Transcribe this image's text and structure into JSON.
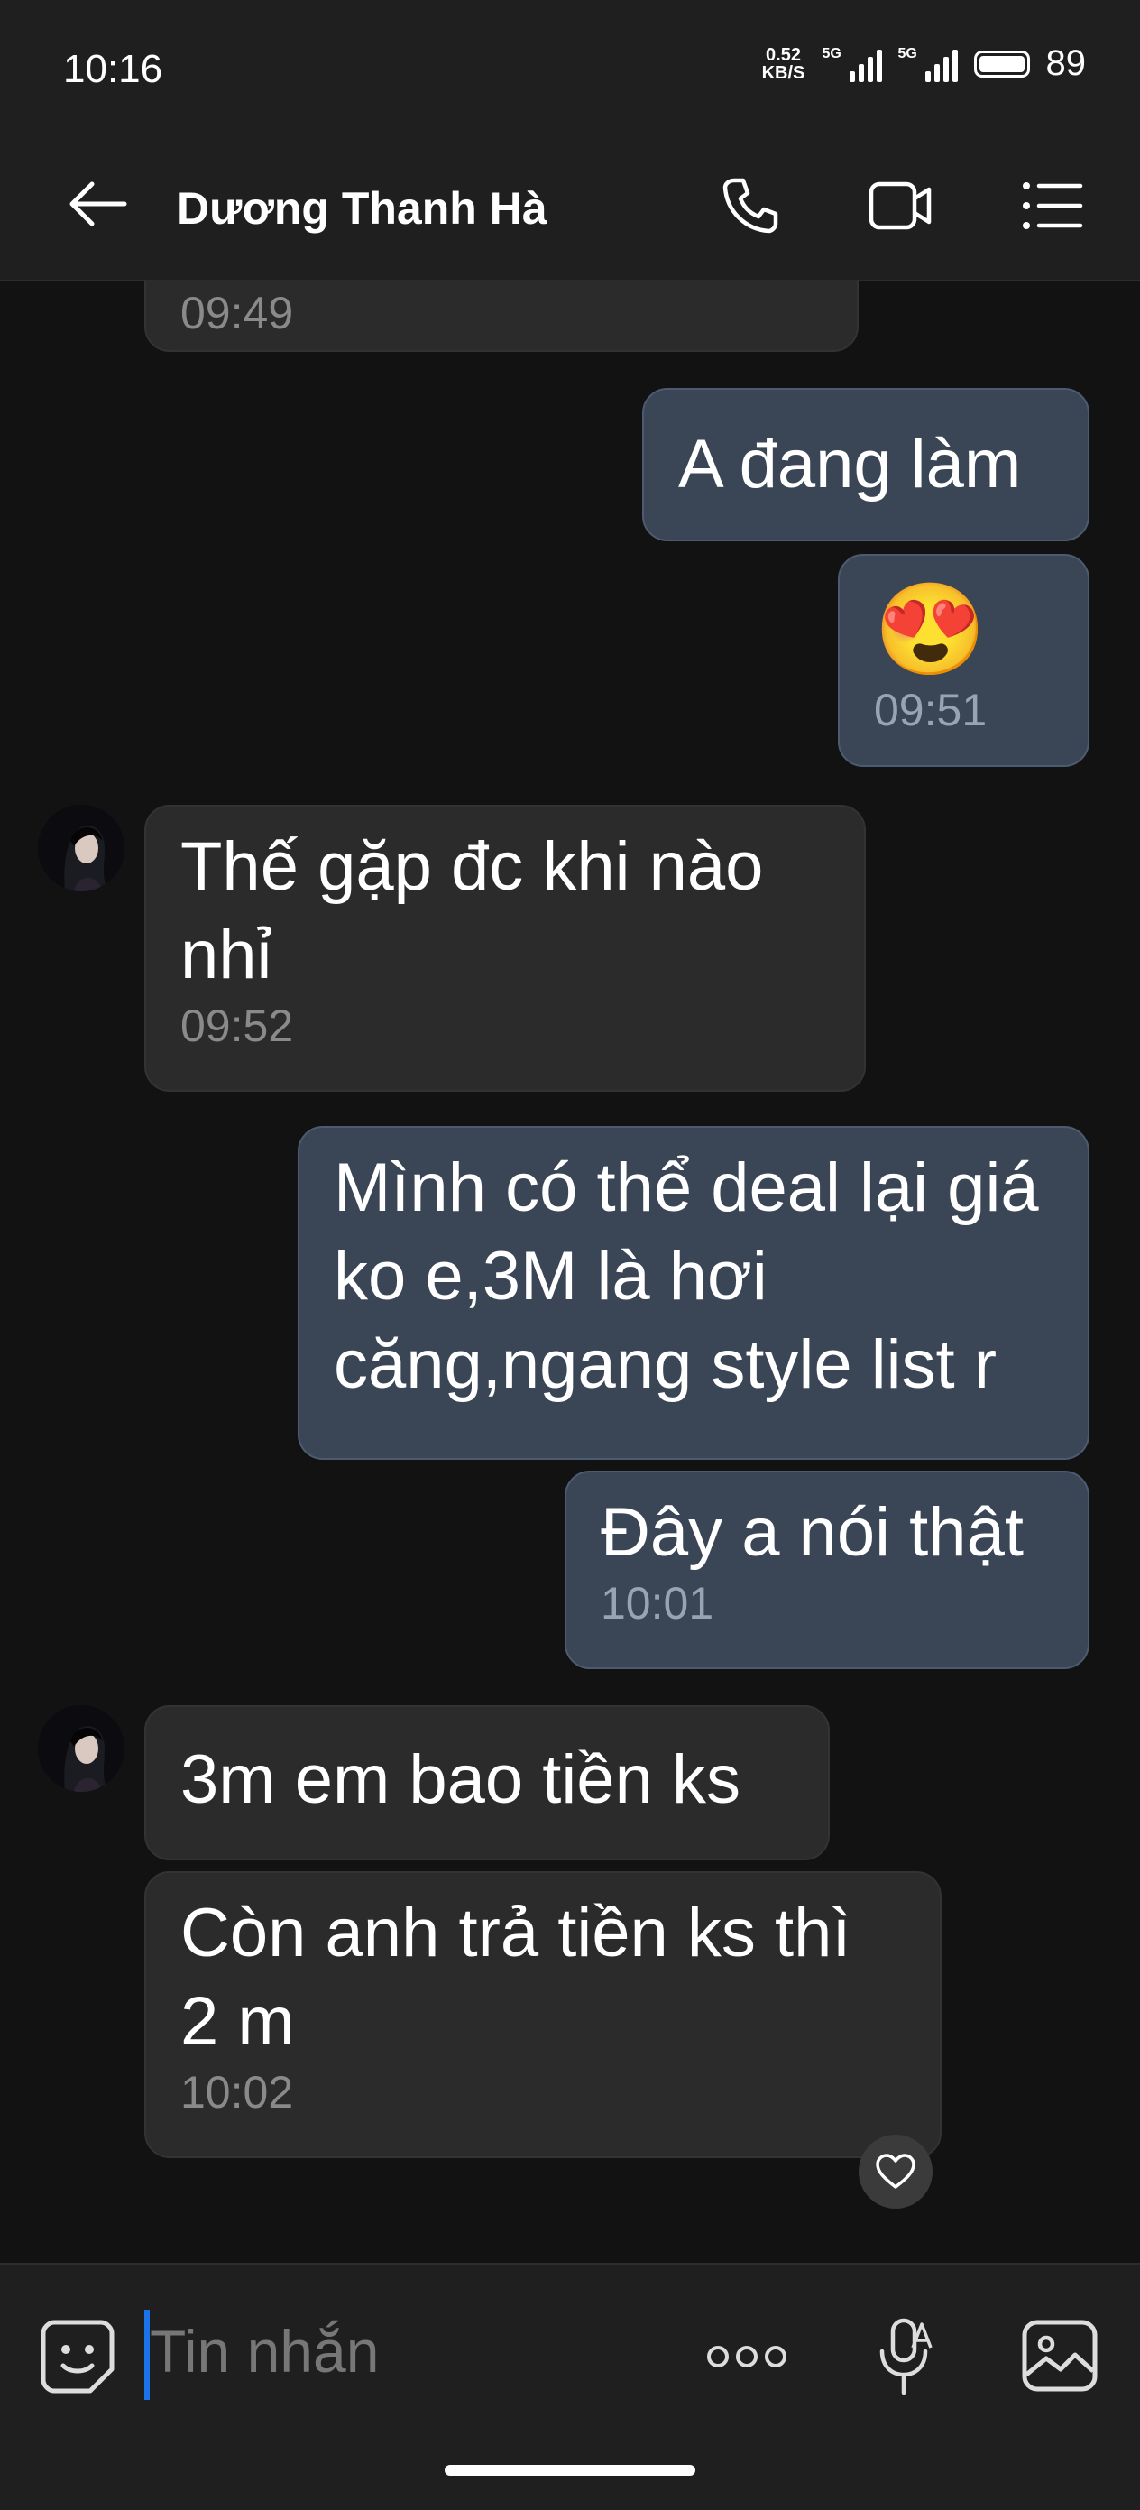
{
  "status": {
    "time": "10:16",
    "net_speed_value": "0.52",
    "net_speed_unit": "KB/S",
    "sim1": "5G",
    "sim2": "5G",
    "battery": "89"
  },
  "header": {
    "title": "Dương Thanh Hà"
  },
  "messages": [
    {
      "dir": "in",
      "text": "",
      "time": "09:49"
    },
    {
      "dir": "out",
      "text": "A đang làm",
      "time": ""
    },
    {
      "dir": "out",
      "text": "😍",
      "time": "09:51"
    },
    {
      "dir": "in",
      "text": "Thế gặp đc khi nào nhỉ",
      "time": "09:52"
    },
    {
      "dir": "out",
      "text": "Mình có thể deal lại giá ko e,3M là hơi căng,ngang style list r",
      "time": ""
    },
    {
      "dir": "out",
      "text": "Đây a nói thật",
      "time": "10:01"
    },
    {
      "dir": "in",
      "text": "3m em bao tiền ks",
      "time": ""
    },
    {
      "dir": "in",
      "text": "Còn anh trả tiền ks thì 2 m",
      "time": "10:02"
    }
  ],
  "input": {
    "placeholder": "Tin nhắn"
  },
  "colors": {
    "incoming_bubble": "#2b2b2b",
    "outgoing_bubble": "#3a4556",
    "caret": "#1a73e8"
  },
  "icons": [
    "back-arrow-icon",
    "phone-icon",
    "video-call-icon",
    "menu-list-icon",
    "sticker-icon",
    "more-icon",
    "voice-to-text-icon",
    "gallery-icon",
    "heart-icon"
  ]
}
